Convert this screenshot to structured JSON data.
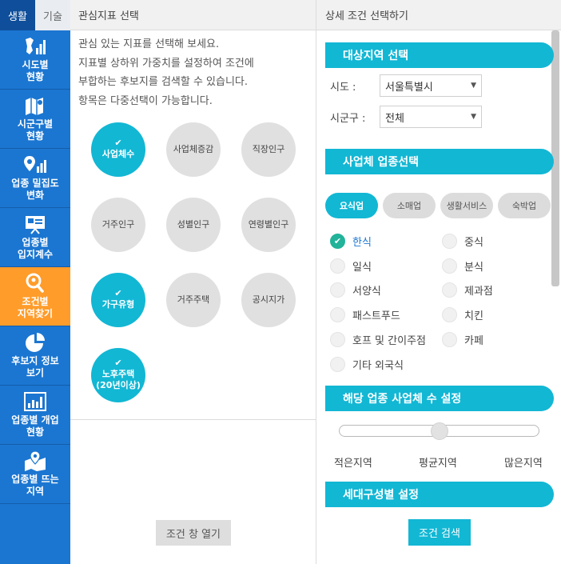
{
  "top_tabs": [
    {
      "label": "생활"
    },
    {
      "label": "기술"
    }
  ],
  "nav": [
    {
      "icon": "region-stats-icon",
      "label": "시도별\n현황"
    },
    {
      "icon": "map-icon",
      "label": "시군구별\n현황"
    },
    {
      "icon": "location-chart-icon",
      "label": "업종 밀집도\n변화"
    },
    {
      "icon": "presentation-board-icon",
      "label": "업종별\n입지계수"
    },
    {
      "icon": "map-search-icon",
      "label": "조건별\n지역찾기"
    },
    {
      "icon": "pie-chart-icon",
      "label": "후보지 정보\n보기"
    },
    {
      "icon": "bar-chart-icon",
      "label": "업종별 개업\n현황"
    },
    {
      "icon": "map-pin-icon",
      "label": "업종별 뜨는\n지역"
    }
  ],
  "middle": {
    "header": "관심지표 선택",
    "description": "관심 있는 지표를 선택해 보세요.\n지표별 상하위 가중치를 설정하여 조건에\n부합하는 후보지를 검색할 수 있습니다.\n항목은 다중선택이 가능합니다.",
    "indicators": [
      {
        "label": "사업체수",
        "selected": true
      },
      {
        "label": "사업체증감",
        "selected": false
      },
      {
        "label": "직장인구",
        "selected": false
      },
      {
        "label": "거주인구",
        "selected": false
      },
      {
        "label": "성별인구",
        "selected": false
      },
      {
        "label": "연령별인구",
        "selected": false
      },
      {
        "label": "가구유형",
        "selected": true
      },
      {
        "label": "거주주택",
        "selected": false
      },
      {
        "label": "공시지가",
        "selected": false
      },
      {
        "label": "노후주택\n(20년이상)",
        "selected": true
      }
    ],
    "open_button": "조건 창 열기"
  },
  "right": {
    "header": "상세 조건 선택하기",
    "region_section": "대상지역 선택",
    "sido_label": "시도 :",
    "sido_value": "서울특별시",
    "sigungu_label": "시군구 :",
    "sigungu_value": "전체",
    "industry_section": "사업체 업종선택",
    "industry_tabs": [
      {
        "label": "요식업",
        "active": true
      },
      {
        "label": "소매업",
        "active": false
      },
      {
        "label": "생활서비스",
        "active": false
      },
      {
        "label": "숙박업",
        "active": false
      }
    ],
    "options": [
      {
        "label": "한식",
        "checked": true
      },
      {
        "label": "중식",
        "checked": false
      },
      {
        "label": "일식",
        "checked": false
      },
      {
        "label": "분식",
        "checked": false
      },
      {
        "label": "서양식",
        "checked": false
      },
      {
        "label": "제과점",
        "checked": false
      },
      {
        "label": "패스트푸드",
        "checked": false
      },
      {
        "label": "치킨",
        "checked": false
      },
      {
        "label": "호프 및 간이주점",
        "checked": false
      },
      {
        "label": "카페",
        "checked": false
      },
      {
        "label": "기타 외국식",
        "checked": false
      }
    ],
    "count_section": "해당 업종 사업체 수 설정",
    "slider_value": 0.5,
    "slider_labels": {
      "low": "적은지역",
      "mid": "평균지역",
      "high": "많은지역"
    },
    "household_section": "세대구성별 설정",
    "search_button": "조건 검색"
  },
  "colors": {
    "sidebar": "#1b76d1",
    "active_nav": "#ff9c2a",
    "accent": "#12b7d4",
    "check": "#22b39a"
  }
}
